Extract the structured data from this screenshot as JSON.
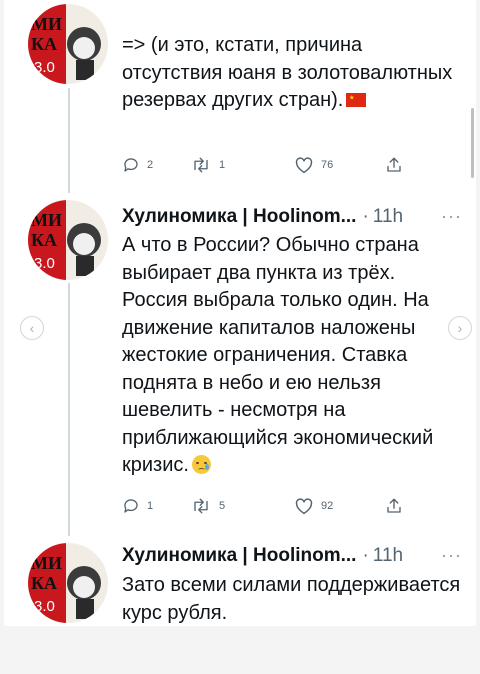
{
  "tweets": [
    {
      "text": "=> (и это, кстати, причина отсутствия юаня в золотовалютных резервах других стран).",
      "replies": "2",
      "retweets": "1",
      "likes": "76",
      "flag_icon": "china-flag-icon"
    },
    {
      "author": "Хулиномика | Hoolinom...",
      "time": "11h",
      "text": "А что в России? Обычно страна выбирает два пункта из трёх. Россия выбрала только один. На движение капиталов наложены жестокие ограничения. Ставка поднята в небо и ею нельзя шевелить - несмотря на приближающийся экономический кризис.",
      "emoji_icon": "crying-face-emoji-icon",
      "replies": "1",
      "retweets": "5",
      "likes": "92"
    },
    {
      "author": "Хулиномика | Hoolinom...",
      "time": "11h",
      "text": "Зато всеми силами поддерживается курс рубля."
    }
  ],
  "avatar": {
    "label_top": "МИ",
    "label_mid": "КА",
    "label_ver": "3.0"
  },
  "more_label": "···",
  "header_dot": "·",
  "nav": {
    "prev": "‹",
    "next": "›"
  },
  "colors": {
    "avatar_red": "#c8181e",
    "secondary_text": "#536471",
    "thread_line": "#cfd9de"
  }
}
